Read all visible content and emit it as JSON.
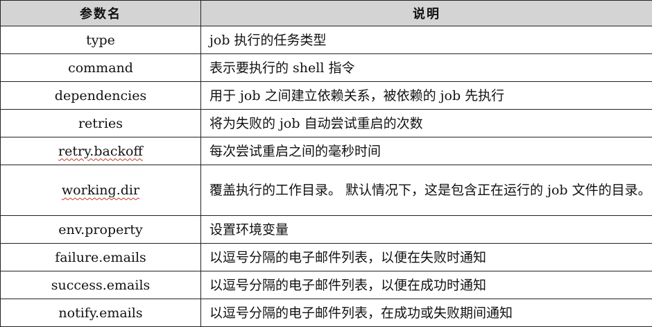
{
  "table": {
    "headers": [
      "参数名",
      "说明"
    ],
    "rows": [
      {
        "name": "type",
        "desc": "job 执行的任务类型"
      },
      {
        "name": "command",
        "desc": "表示要执行的 shell 指令"
      },
      {
        "name": "dependencies",
        "desc": "用于 job 之间建立依赖关系，被依赖的 job 先执行"
      },
      {
        "name": "retries",
        "desc": "将为失败的 job 自动尝试重启的次数"
      },
      {
        "name": "retry.backoff",
        "desc": "每次尝试重启之间的毫秒时间"
      },
      {
        "name": "working.dir",
        "desc": "覆盖执行的工作目录。 默认情况下，这是包含正在运行的 job 文件的目录。"
      },
      {
        "name": "env.property",
        "desc": "设置环境变量"
      },
      {
        "name": "failure.emails",
        "desc": "以逗号分隔的电子邮件列表，以便在失败时通知"
      },
      {
        "name": "success.emails",
        "desc": "以逗号分隔的电子邮件列表，以便在成功时通知"
      },
      {
        "name": "notify.emails",
        "desc": "以逗号分隔的电子邮件列表，在成功或失败期间通知"
      }
    ]
  }
}
